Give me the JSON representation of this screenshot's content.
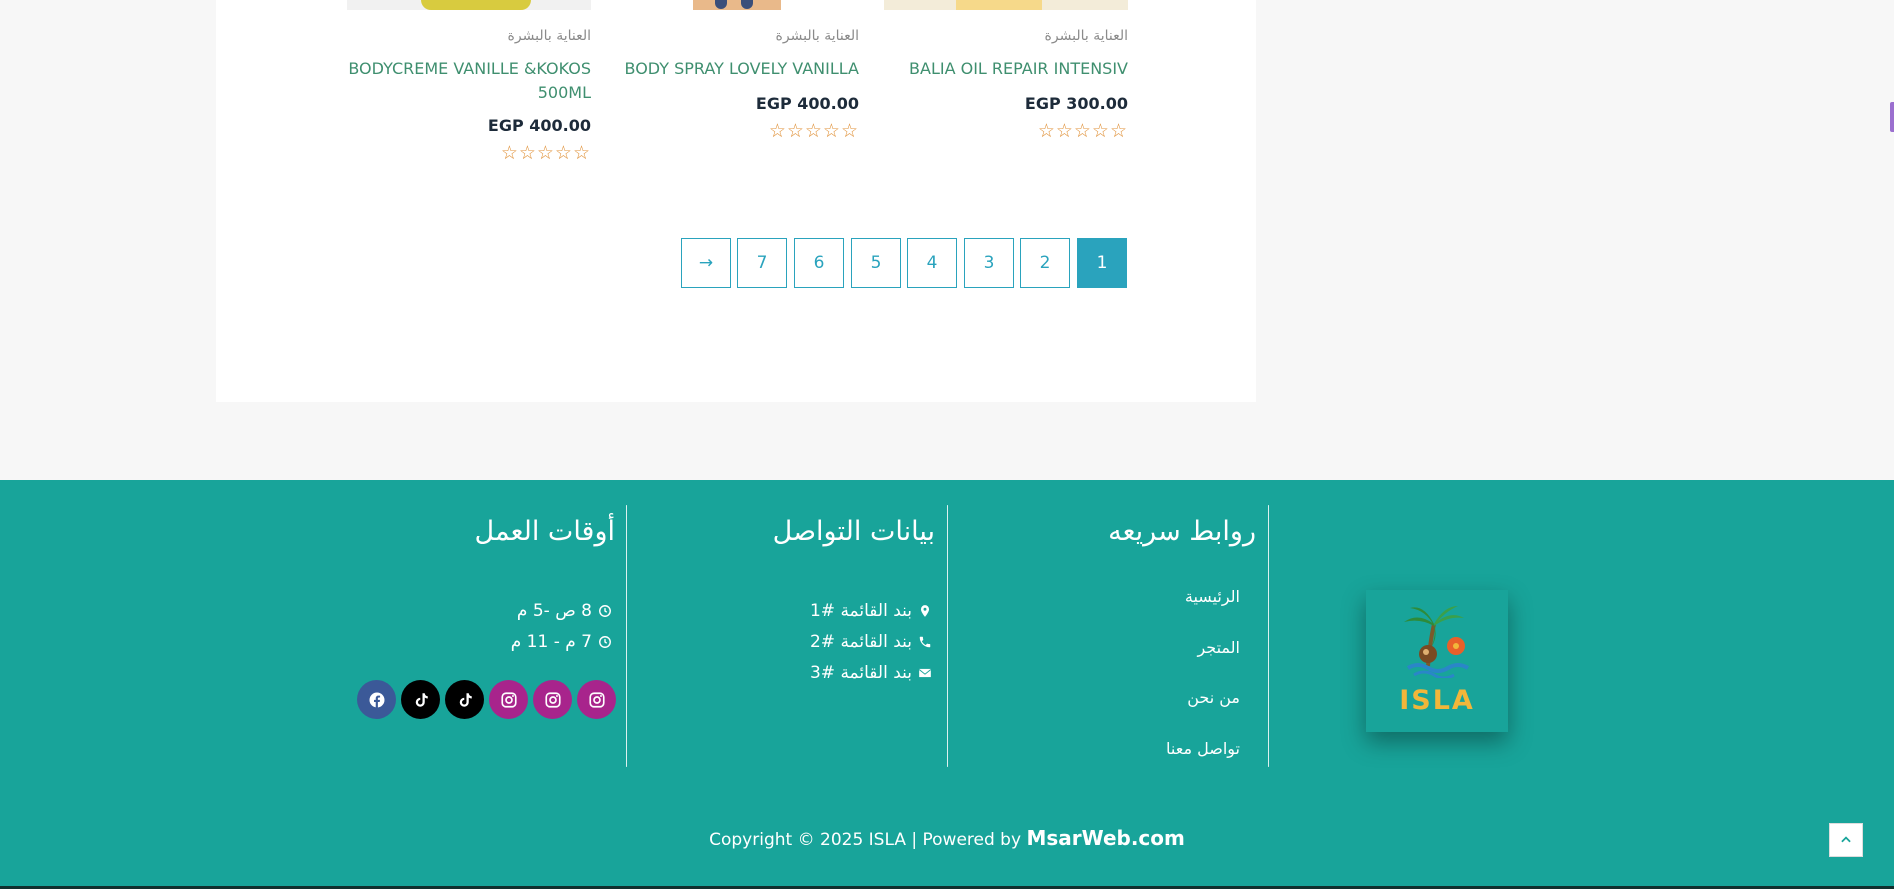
{
  "products": [
    {
      "category": "العناية بالبشرة",
      "title": "BODYCREME VANILLE &KOKOS 500ML",
      "price": "EGP 400.00",
      "rating": 0
    },
    {
      "category": "العناية بالبشرة",
      "title": "BODY SPRAY LOVELY VANILLA",
      "price": "EGP 400.00",
      "rating": 0
    },
    {
      "category": "العناية بالبشرة",
      "title": "BALIA OIL REPAIR INTENSIV",
      "price": "EGP 300.00",
      "rating": 0
    }
  ],
  "pagination": {
    "pages": [
      "1",
      "2",
      "3",
      "4",
      "5",
      "6",
      "7"
    ],
    "current": "1",
    "next_label": "→"
  },
  "footer": {
    "quick_links": {
      "title": "روابط سريعه",
      "items": [
        "الرئيسية",
        "المتجر",
        "من نحن",
        "تواصل معنا"
      ]
    },
    "contact": {
      "title": "بيانات التواصل",
      "items": [
        {
          "icon": "map-marker-icon",
          "text": "بند القائمة #1"
        },
        {
          "icon": "phone-icon",
          "text": "بند القائمة #2"
        },
        {
          "icon": "envelope-icon",
          "text": "بند القائمة #3"
        }
      ]
    },
    "hours": {
      "title": "أوقات العمل",
      "items": [
        {
          "icon": "clock-icon",
          "text": "8 ص -5 م"
        },
        {
          "icon": "clock-icon",
          "text": "7 م - 11 م"
        }
      ]
    },
    "social": [
      "instagram-icon",
      "instagram-icon",
      "instagram-icon",
      "tiktok-icon",
      "tiktok-icon",
      "facebook-icon"
    ],
    "logo_text": "ISLA",
    "copyright_prefix": "Copyright © 2025 ISLA | Powered by ",
    "copyright_brand": "MsarWeb.com"
  },
  "colors": {
    "footer_bg": "#18a49a",
    "accent": "#2aa3bd",
    "product_title": "#3f8f6f",
    "stars": "#e0923a",
    "instagram": "#a8248c",
    "tiktok": "#000000",
    "facebook": "#3b5998"
  }
}
